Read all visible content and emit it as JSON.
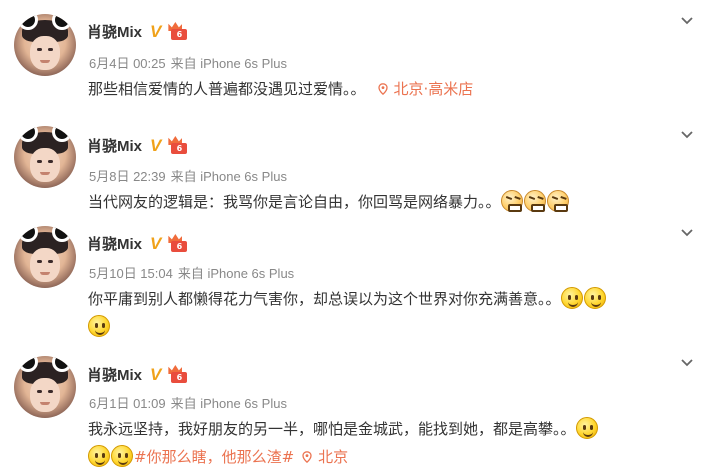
{
  "posts": [
    {
      "author": "肖骁Mix",
      "verified": "V",
      "date": "6月4日 00:25",
      "source": "来自 iPhone 6s Plus",
      "text": "那些相信爱情的人普遍都没遇见过爱情。。",
      "location": "北京·高米店",
      "emoji": []
    },
    {
      "author": "肖骁Mix",
      "verified": "V",
      "date": "5月8日 22:39",
      "source": "来自 iPhone 6s Plus",
      "text": "当代网友的逻辑是：我骂你是言论自由，你回骂是网络暴力。。",
      "emoji": [
        "angry-emoji",
        "angry-emoji",
        "angry-emoji"
      ]
    },
    {
      "author": "肖骁Mix",
      "verified": "V",
      "date": "5月10日 15:04",
      "source": "来自 iPhone 6s Plus",
      "text": "你平庸到别人都懒得花力气害你，却总误以为这个世界对你充满善意。。",
      "emoji": [
        "smile-emoji",
        "smile-emoji",
        "smile-emoji"
      ]
    },
    {
      "author": "肖骁Mix",
      "verified": "V",
      "date": "6月1日 01:09",
      "source": "来自 iPhone 6s Plus",
      "text": "我永远坚持，我好朋友的另一半，哪怕是金城武，能找到她，都是高攀。。",
      "hashtag": "#你那么瞎，他那么渣#",
      "location": "北京",
      "emoji": [
        "smile-emoji",
        "smile-emoji",
        "smile-emoji"
      ]
    }
  ],
  "colors": {
    "accent": "#eb7350",
    "verified": "#f0a21a",
    "meta": "#888888"
  }
}
